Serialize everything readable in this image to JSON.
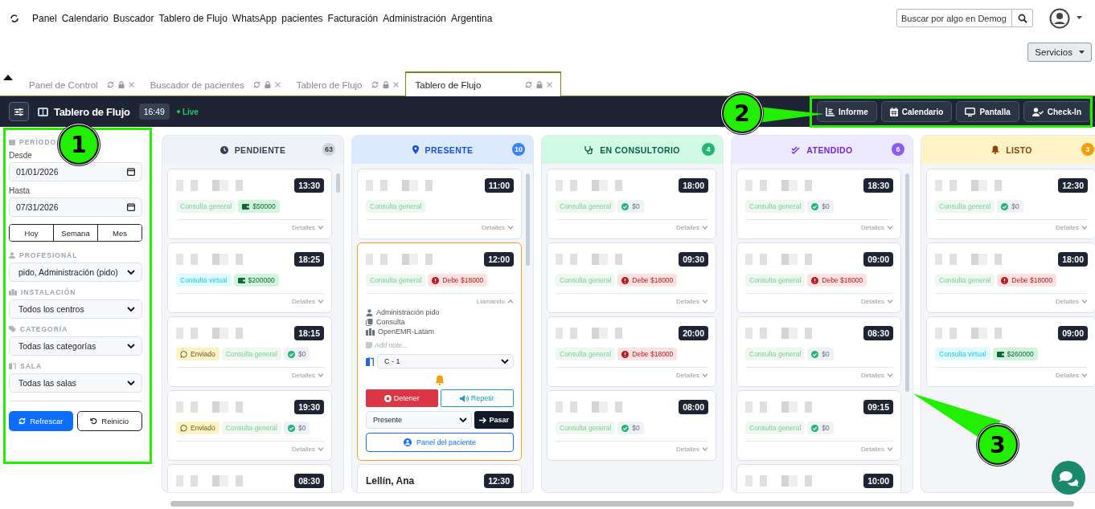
{
  "nav": {
    "menu": [
      "Panel",
      "Calendario",
      "Buscador",
      "Tablero de Flujo",
      "WhatsApp",
      "pacientes",
      "Facturación",
      "Administración",
      "Argentina"
    ],
    "search": {
      "placeholder": "Buscar por algo en Demog"
    },
    "services": "Servicios"
  },
  "tabs": [
    {
      "label": "Panel de Control",
      "selected": false
    },
    {
      "label": "Buscador de pacientes",
      "selected": false
    },
    {
      "label": "Tablero de Flujo",
      "selected": false
    },
    {
      "label": "Tablero de Flujo",
      "selected": true
    }
  ],
  "toolbar": {
    "title": "Tablero de Flujo",
    "time": "16:49",
    "live": "Live",
    "buttons": [
      {
        "label": "Informe",
        "kind": "report"
      },
      {
        "label": "Calendario",
        "kind": "calendar"
      },
      {
        "label": "Pantalla",
        "kind": "screen"
      },
      {
        "label": "Check-In",
        "kind": "checkin"
      }
    ]
  },
  "filters": {
    "period": "PERÍODO",
    "from_label": "Desde",
    "from_value": "01/01/2026",
    "to_label": "Hasta",
    "to_value": "07/31/2026",
    "ranges": [
      "Hoy",
      "Semana",
      "Mes"
    ],
    "selects": [
      {
        "label": "PROFESIONAL",
        "kind": "user",
        "value": "pido, Administración (pido)"
      },
      {
        "label": "INSTALACIÓN",
        "kind": "building",
        "value": "Todos los centros"
      },
      {
        "label": "CATEGORÍA",
        "kind": "tags",
        "value": "Todas las categorías"
      },
      {
        "label": "SALA",
        "kind": "door",
        "value": "Todas las salas"
      }
    ],
    "refresh": "Refrescar",
    "reset": "Reinicio"
  },
  "columns": [
    {
      "title": "PENDIENTE",
      "kind": "pending",
      "count": "63",
      "color": "#ced4da",
      "cards": [
        {
          "time": "13:30",
          "tags": [
            {
              "label": "Consulta general",
              "kind": "category"
            },
            {
              "label": "$50000",
              "kind": "paid"
            }
          ],
          "toggle": "Detalles",
          "expanded": false
        },
        {
          "time": "18:25",
          "tags": [
            {
              "label": "Consulta virtual",
              "kind": "virtual"
            },
            {
              "label": "$200000",
              "kind": "paid"
            }
          ],
          "toggle": "Detalles",
          "expanded": false
        },
        {
          "time": "18:15",
          "tags": [
            {
              "label": "Enviado",
              "kind": "sent"
            },
            {
              "label": "Consulta general",
              "kind": "category"
            },
            {
              "label": "$0",
              "kind": "zero"
            }
          ],
          "toggle": "Detalles",
          "expanded": false
        },
        {
          "time": "19:30",
          "tags": [
            {
              "label": "Enviado",
              "kind": "sent"
            },
            {
              "label": "Consulta general",
              "kind": "category"
            },
            {
              "label": "$0",
              "kind": "zero"
            }
          ],
          "toggle": "Detalles",
          "expanded": false
        },
        {
          "time": "08:30",
          "expanded": false
        }
      ]
    },
    {
      "title": "PRESENTE",
      "kind": "present",
      "count": "10",
      "color": "#3b82f6",
      "cards": [
        {
          "time": "11:00",
          "tags": [
            {
              "label": "Consulta general",
              "kind": "category"
            }
          ],
          "toggle": "Detalles",
          "expanded": false
        },
        {
          "time": "12:00",
          "tags": [
            {
              "label": "Consulta general",
              "kind": "category"
            },
            {
              "label": "Debe $18000",
              "kind": "debt"
            }
          ],
          "toggle": "Llamando",
          "expanded": true,
          "detail": {
            "provider": "Administración pido",
            "visit": "Consulta",
            "facility": "OpenEMR-Latam",
            "note_placeholder": "Add note...",
            "room": "C - 1",
            "stop": "Detener",
            "repeat": "Repetir",
            "status": "Presente",
            "move": "Pasar",
            "panel": "Panel del paciente"
          }
        },
        {
          "name": "Lellín, Ana",
          "time": "12:30",
          "expanded": false
        }
      ]
    },
    {
      "title": "EN CONSULTORIO",
      "kind": "room",
      "count": "4",
      "color": "#22b573",
      "cards": [
        {
          "time": "18:00",
          "tags": [
            {
              "label": "Consulta general",
              "kind": "category"
            },
            {
              "label": "$0",
              "kind": "zero"
            }
          ],
          "toggle": "Detalles",
          "expanded": false
        },
        {
          "time": "09:30",
          "tags": [
            {
              "label": "Consulta general",
              "kind": "category"
            },
            {
              "label": "Debe $18000",
              "kind": "debt"
            }
          ],
          "toggle": "Detalles",
          "expanded": false
        },
        {
          "time": "20:00",
          "tags": [
            {
              "label": "Consulta general",
              "kind": "category"
            },
            {
              "label": "Debe $18000",
              "kind": "debt"
            }
          ],
          "toggle": "Detalles",
          "expanded": false
        },
        {
          "time": "08:00",
          "tags": [
            {
              "label": "Consulta general",
              "kind": "category"
            },
            {
              "label": "$0",
              "kind": "zero"
            }
          ],
          "toggle": "Detalles",
          "expanded": false
        }
      ]
    },
    {
      "title": "ATENDIDO",
      "kind": "done",
      "count": "6",
      "color": "#8b5cf6",
      "cards": [
        {
          "time": "18:30",
          "tags": [
            {
              "label": "Consulta general",
              "kind": "category"
            },
            {
              "label": "$0",
              "kind": "zero"
            }
          ],
          "toggle": "Detalles",
          "expanded": false
        },
        {
          "time": "09:00",
          "tags": [
            {
              "label": "Consulta general",
              "kind": "category"
            },
            {
              "label": "Debe $18000",
              "kind": "debt"
            }
          ],
          "toggle": "Detalles",
          "expanded": false
        },
        {
          "time": "08:30",
          "tags": [
            {
              "label": "Consulta general",
              "kind": "category"
            },
            {
              "label": "$0",
              "kind": "zero"
            }
          ],
          "toggle": "Detalles",
          "expanded": false
        },
        {
          "time": "09:15",
          "tags": [
            {
              "label": "Consulta general",
              "kind": "category"
            },
            {
              "label": "$0",
              "kind": "zero"
            }
          ],
          "toggle": "Detalles",
          "expanded": false
        },
        {
          "time": "10:00",
          "expanded": false
        }
      ]
    },
    {
      "title": "LISTO",
      "kind": "ready",
      "count": "3",
      "color": "#f59e0b",
      "cards": [
        {
          "time": "12:30",
          "tags": [
            {
              "label": "Consulta general",
              "kind": "category"
            },
            {
              "label": "$0",
              "kind": "zero"
            }
          ],
          "toggle": "Detalles",
          "expanded": false
        },
        {
          "time": "18:00",
          "tags": [
            {
              "label": "Consulta general",
              "kind": "category"
            },
            {
              "label": "Debe $18000",
              "kind": "debt"
            }
          ],
          "toggle": "Detalles",
          "expanded": false
        },
        {
          "time": "09:00",
          "tags": [
            {
              "label": "Consulta virtual",
              "kind": "virtual"
            },
            {
              "label": "$260000",
              "kind": "paid"
            }
          ],
          "toggle": "Detalles",
          "expanded": false
        }
      ]
    }
  ],
  "annotations": [
    {
      "label": "1"
    },
    {
      "label": "2"
    },
    {
      "label": "3"
    }
  ]
}
